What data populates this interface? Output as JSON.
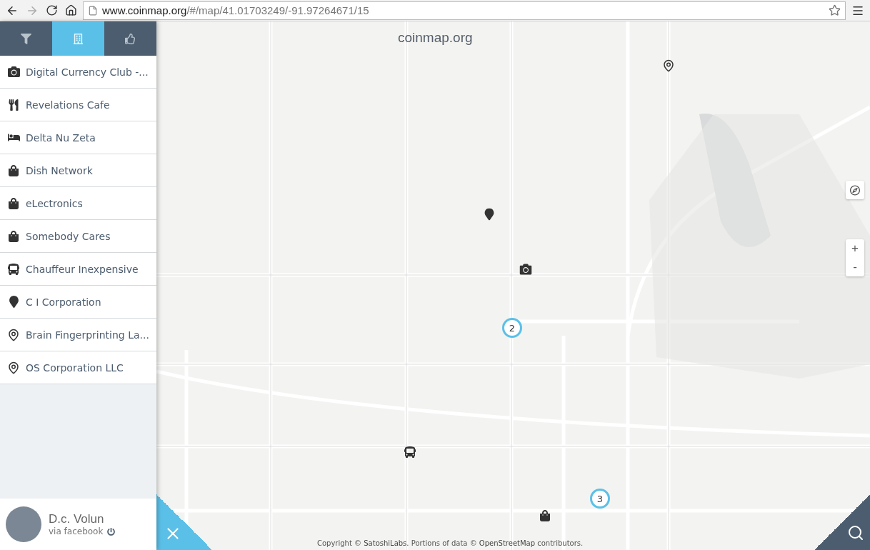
{
  "browser": {
    "url_host": "www.coinmap.org",
    "url_path": "/#/map/41.01703249/-91.97264671/15"
  },
  "sidebar": {
    "tabs": [
      {
        "kind": "filter",
        "selected": false
      },
      {
        "kind": "venues",
        "selected": true
      },
      {
        "kind": "like",
        "selected": false
      }
    ],
    "items": [
      {
        "kind": "camera",
        "name": "Digital Currency Club -..."
      },
      {
        "kind": "food",
        "name": "Revelations Cafe"
      },
      {
        "kind": "bed",
        "name": "Delta Nu Zeta"
      },
      {
        "kind": "bag",
        "name": "Dish Network"
      },
      {
        "kind": "bag",
        "name": "eLectronics"
      },
      {
        "kind": "bag",
        "name": "Somebody Cares"
      },
      {
        "kind": "bus",
        "name": "Chauffeur Inexpensive"
      },
      {
        "kind": "pin",
        "name": "C I Corporation"
      },
      {
        "kind": "pin-outline",
        "name": "Brain Fingerprinting La..."
      },
      {
        "kind": "pin-outline",
        "name": "OS Corporation LLC"
      }
    ],
    "user": {
      "name": "D.c. Volun",
      "via": "via facebook"
    }
  },
  "map": {
    "title": "coinmap.org",
    "markers": [
      {
        "kind": "pin-outline"
      },
      {
        "kind": "pin"
      },
      {
        "kind": "camera"
      },
      {
        "kind": "bus"
      },
      {
        "kind": "bag"
      }
    ],
    "clusters": [
      {
        "count": "2"
      },
      {
        "count": "3"
      }
    ],
    "zoom_in": "+",
    "zoom_out": "-",
    "attribution": {
      "prefix": "Copyright © ",
      "owner": "SatoshiLabs",
      "middle": ". Portions of data © ",
      "source": "OpenStreetMap",
      "suffix": " contributors."
    }
  }
}
